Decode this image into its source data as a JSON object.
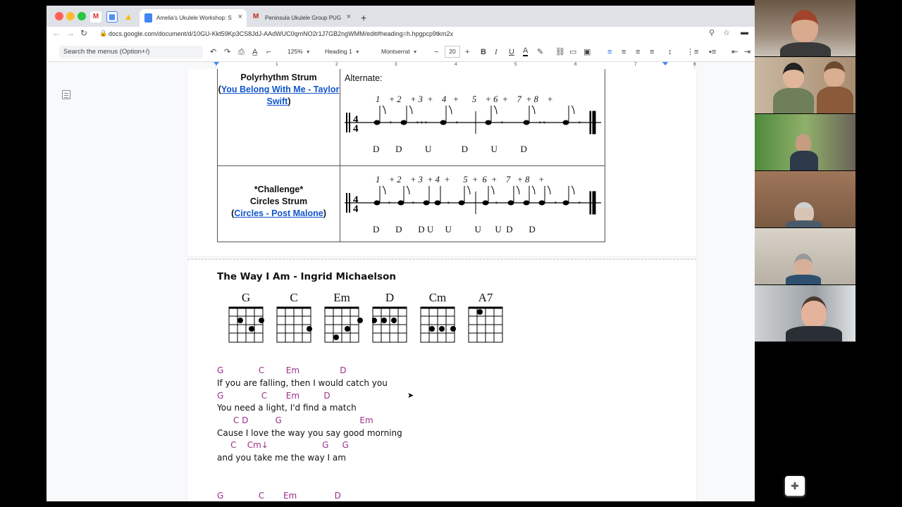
{
  "browser": {
    "tabs": [
      {
        "label": "Amelia's Ukulele Workshop: S",
        "active": true
      },
      {
        "label": "Peninsula Ukulele Group PUG",
        "active": false
      }
    ],
    "url": "docs.google.com/document/d/10GU-Kkt59Kp3CS8JdJ-AAdWUC0qmNO2r1J7GB2ngWMM/edit#heading=h.hpgpcp9tkm2x"
  },
  "toolbar": {
    "menu_search": "Search the menus (Option+/)",
    "zoom": "125%",
    "style": "Heading 1",
    "font": "Montserrat",
    "font_size": "20"
  },
  "ruler": {
    "numbers": [
      "1",
      "2",
      "3",
      "4",
      "5",
      "6",
      "7",
      "8"
    ]
  },
  "strum_table": {
    "row1": {
      "name": "Polyrhythm Strum",
      "link": "You Belong With Me - Taylor Swift",
      "alt_label": "Alternate:",
      "beats": "1    + 2    + 3  +    4   +      5    + 6  +    7  + 8    +",
      "strums": "D       D          U             D          U          D"
    },
    "row2": {
      "name_line1": "*Challenge*",
      "name_line2": "Circles Strum",
      "link": "Circles - Post Malone",
      "beats": "1    + 2    + 3  + 4  +      5  +  6  +    7   + 8    +",
      "strums": "D       D       D U     U          U      U  D       D"
    }
  },
  "song": {
    "title": "The Way I Am - Ingrid Michaelson",
    "chord_diagrams": [
      "G",
      "C",
      "Em",
      "D",
      "Cm",
      "A7"
    ],
    "lines": [
      {
        "chords": "G             C        Em               D",
        "lyric": "If you are falling, then I would catch you"
      },
      {
        "chords": "G              C       Em         D",
        "lyric": "You need a light, I'd find a match"
      },
      {
        "chords": "      C D          G                             Em",
        "lyric": "Cause I love the way you say good morning"
      },
      {
        "chords": "     C    Cm↓                    G     G",
        "lyric": "and you take me the way I am"
      },
      {
        "chords": "G             C       Em              D",
        "lyric": ""
      }
    ]
  }
}
